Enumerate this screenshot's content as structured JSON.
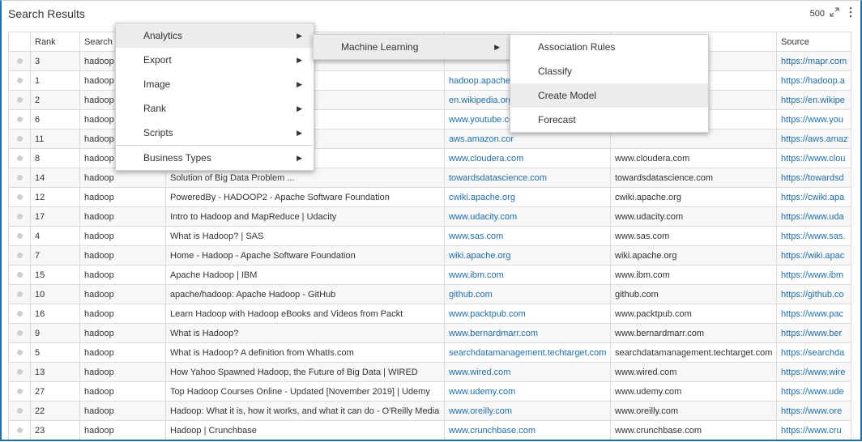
{
  "panel": {
    "title": "Search Results",
    "count": "500",
    "expand_icon": "expand-arrows-icon",
    "more_icon": "vertical-ellipsis-icon"
  },
  "columns": [
    "",
    "Rank",
    "Search T",
    "",
    "",
    "",
    "Source"
  ],
  "rows": [
    {
      "rank": "3",
      "search_term": "hadoop",
      "title": "",
      "domain_link": "",
      "domain": "",
      "source": "https://mapr.com"
    },
    {
      "rank": "1",
      "search_term": "hadoop",
      "title": "",
      "domain_link": "hadoop.apache.",
      "domain": "",
      "source": "https://hadoop.a"
    },
    {
      "rank": "2",
      "search_term": "hadoop",
      "title": "",
      "domain_link": "en.wikipedia.org",
      "domain": "",
      "source": "https://en.wikipe"
    },
    {
      "rank": "6",
      "search_term": "hadoop",
      "title": "",
      "domain_link": "www.youtube.co",
      "domain": "",
      "source": "https://www.you"
    },
    {
      "rank": "11",
      "search_term": "hadoop",
      "title": "",
      "domain_link": "aws.amazon.cor",
      "domain": "",
      "source": "https://aws.amaz"
    },
    {
      "rank": "8",
      "search_term": "hadoop",
      "title": "ompany",
      "domain_link": "www.cloudera.com",
      "domain": "www.cloudera.com",
      "source": "https://www.clou"
    },
    {
      "rank": "14",
      "search_term": "hadoop",
      "title": "Solution of Big Data Problem ...",
      "domain_link": "towardsdatascience.com",
      "domain": "towardsdatascience.com",
      "source": "https://towardsd"
    },
    {
      "rank": "12",
      "search_term": "hadoop",
      "title": "PoweredBy - HADOOP2 - Apache Software Foundation",
      "domain_link": "cwiki.apache.org",
      "domain": "cwiki.apache.org",
      "source": "https://cwiki.apa"
    },
    {
      "rank": "17",
      "search_term": "hadoop",
      "title": "Intro to Hadoop and MapReduce | Udacity",
      "domain_link": "www.udacity.com",
      "domain": "www.udacity.com",
      "source": "https://www.uda"
    },
    {
      "rank": "4",
      "search_term": "hadoop",
      "title": "What is Hadoop? | SAS",
      "domain_link": "www.sas.com",
      "domain": "www.sas.com",
      "source": "https://www.sas."
    },
    {
      "rank": "7",
      "search_term": "hadoop",
      "title": "Home - Hadoop - Apache Software Foundation",
      "domain_link": "wiki.apache.org",
      "domain": "wiki.apache.org",
      "source": "https://wiki.apac"
    },
    {
      "rank": "15",
      "search_term": "hadoop",
      "title": "Apache Hadoop | IBM",
      "domain_link": "www.ibm.com",
      "domain": "www.ibm.com",
      "source": "https://www.ibm"
    },
    {
      "rank": "10",
      "search_term": "hadoop",
      "title": "apache/hadoop: Apache Hadoop - GitHub",
      "domain_link": "github.com",
      "domain": "github.com",
      "source": "https://github.co"
    },
    {
      "rank": "16",
      "search_term": "hadoop",
      "title": "Learn Hadoop with Hadoop eBooks and Videos from Packt",
      "domain_link": "www.packtpub.com",
      "domain": "www.packtpub.com",
      "source": "https://www.pac"
    },
    {
      "rank": "9",
      "search_term": "hadoop",
      "title": "What is Hadoop?",
      "domain_link": "www.bernardmarr.com",
      "domain": "www.bernardmarr.com",
      "source": "https://www.ber"
    },
    {
      "rank": "5",
      "search_term": "hadoop",
      "title": "What is Hadoop? A definition from WhatIs.com",
      "domain_link": "searchdatamanagement.techtarget.com",
      "domain": "searchdatamanagement.techtarget.com",
      "source": "https://searchda"
    },
    {
      "rank": "13",
      "search_term": "hadoop",
      "title": "How Yahoo Spawned Hadoop, the Future of Big Data | WIRED",
      "domain_link": "www.wired.com",
      "domain": "www.wired.com",
      "source": "https://www.wire"
    },
    {
      "rank": "27",
      "search_term": "hadoop",
      "title": "Top Hadoop Courses Online - Updated [November 2019] | Udemy",
      "domain_link": "www.udemy.com",
      "domain": "www.udemy.com",
      "source": "https://www.ude"
    },
    {
      "rank": "22",
      "search_term": "hadoop",
      "title": "Hadoop: What it is, how it works, and what it can do - O'Reilly Media",
      "domain_link": "www.oreilly.com",
      "domain": "www.oreilly.com",
      "source": "https://www.ore"
    },
    {
      "rank": "23",
      "search_term": "hadoop",
      "title": "Hadoop | Crunchbase",
      "domain_link": "www.crunchbase.com",
      "domain": "www.crunchbase.com",
      "source": "https://www.cru"
    }
  ],
  "context_menu": {
    "items": [
      {
        "label": "Analytics",
        "has_submenu": true,
        "active": true
      },
      {
        "label": "Export",
        "has_submenu": true
      },
      {
        "label": "Image",
        "has_submenu": true
      },
      {
        "label": "Rank",
        "has_submenu": true
      },
      {
        "label": "Scripts",
        "has_submenu": true
      },
      {
        "label": "Business Types",
        "has_submenu": true
      }
    ]
  },
  "analytics_menu": {
    "items": [
      {
        "label": "Machine Learning",
        "has_submenu": true,
        "active": true
      }
    ]
  },
  "ml_menu": {
    "items": [
      {
        "label": "Association Rules"
      },
      {
        "label": "Classify"
      },
      {
        "label": "Create Model",
        "active": true
      },
      {
        "label": "Forecast"
      }
    ]
  },
  "colors": {
    "accent": "#1f6fa8",
    "link": "#1f6fa8"
  }
}
